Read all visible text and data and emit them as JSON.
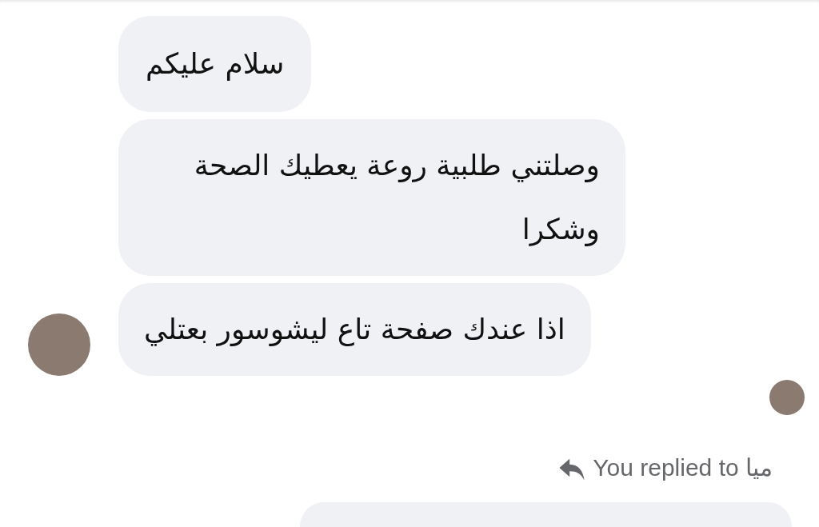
{
  "incoming": {
    "messages": [
      {
        "text": "سلام عليكم"
      },
      {
        "text": "وصلتني طلبية روعة يعطيك الصحة وشكرا"
      },
      {
        "text": "اذا عندك صفحة تاع ليشوسور بعتلي"
      }
    ]
  },
  "reply_notice": {
    "prefix": "You replied to",
    "name": "ميا"
  }
}
